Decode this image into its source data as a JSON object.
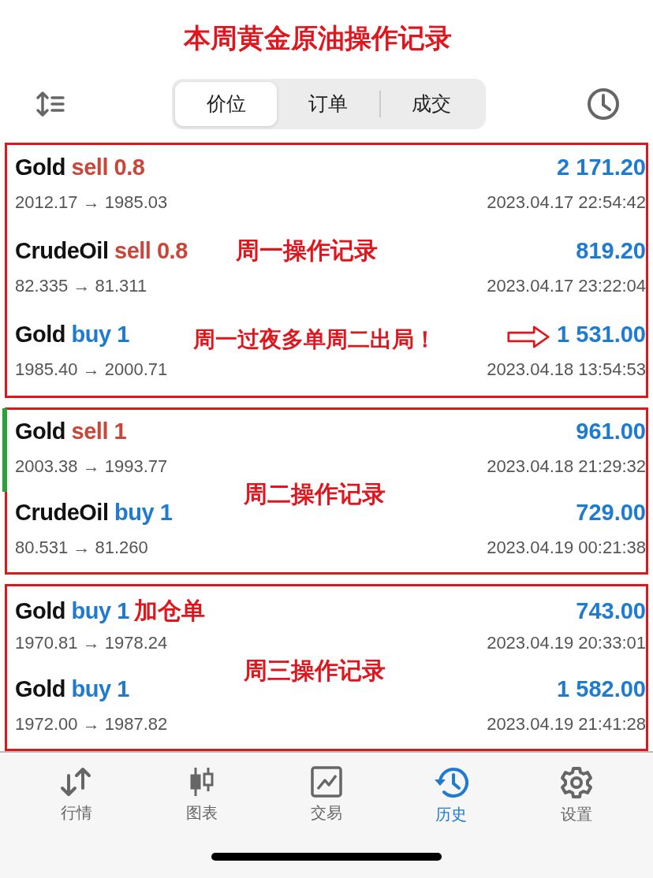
{
  "title": "本周黄金原油操作记录",
  "tabs": [
    {
      "label": "价位",
      "selected": true
    },
    {
      "label": "订单",
      "selected": false
    },
    {
      "label": "成交",
      "selected": false
    }
  ],
  "groups": [
    {
      "trades": [
        {
          "symbol": "Gold",
          "kind": "sell",
          "action": "sell 0.8",
          "profit": "2 171.20",
          "prices": "2012.17 → 1985.03",
          "time": "2023.04.17 22:54:42",
          "highlighted": false
        },
        {
          "symbol": "CrudeOil",
          "kind": "sell",
          "action": "sell 0.8",
          "profit": "819.20",
          "prices": "82.335 → 81.311",
          "time": "2023.04.17 23:22:04",
          "highlighted": false,
          "note": {
            "kind": "overlay",
            "text": "周一操作记录"
          }
        },
        {
          "symbol": "Gold",
          "kind": "buy",
          "action": "buy 1",
          "profit": "1 531.00",
          "prices": "1985.40 → 2000.71",
          "time": "2023.04.18 13:54:53",
          "highlighted": false,
          "note": {
            "kind": "callout",
            "text": "周一过夜多单周二出局！"
          }
        }
      ]
    },
    {
      "trades": [
        {
          "symbol": "Gold",
          "kind": "sell",
          "action": "sell 1",
          "profit": "961.00",
          "prices": "2003.38 → 1993.77",
          "time": "2023.04.18 21:29:32",
          "highlighted": true
        },
        {
          "symbol": "CrudeOil",
          "kind": "buy",
          "action": "buy 1",
          "profit": "729.00",
          "prices": "80.531 → 81.260",
          "time": "2023.04.19 00:21:38",
          "highlighted": false,
          "note": {
            "kind": "between",
            "text": "周二操作记录"
          }
        }
      ]
    },
    {
      "trades": [
        {
          "symbol": "Gold",
          "kind": "buy",
          "action": "buy 1",
          "tag": "加仓单",
          "profit": "743.00",
          "prices": "1970.81 → 1978.24",
          "time": "2023.04.19 20:33:01",
          "highlighted": false
        },
        {
          "symbol": "Gold",
          "kind": "buy",
          "action": "buy 1",
          "profit": "1 582.00",
          "prices": "1972.00 → 1987.82",
          "time": "2023.04.19 21:41:28",
          "highlighted": false,
          "note": {
            "kind": "between",
            "text": "周三操作记录"
          }
        }
      ]
    }
  ],
  "nav": [
    {
      "kind": "quotes",
      "label": "行情",
      "selected": false
    },
    {
      "kind": "chart",
      "label": "图表",
      "selected": false
    },
    {
      "kind": "trade",
      "label": "交易",
      "selected": false
    },
    {
      "kind": "history",
      "label": "历史",
      "selected": true
    },
    {
      "kind": "settings",
      "label": "设置",
      "selected": false
    }
  ]
}
